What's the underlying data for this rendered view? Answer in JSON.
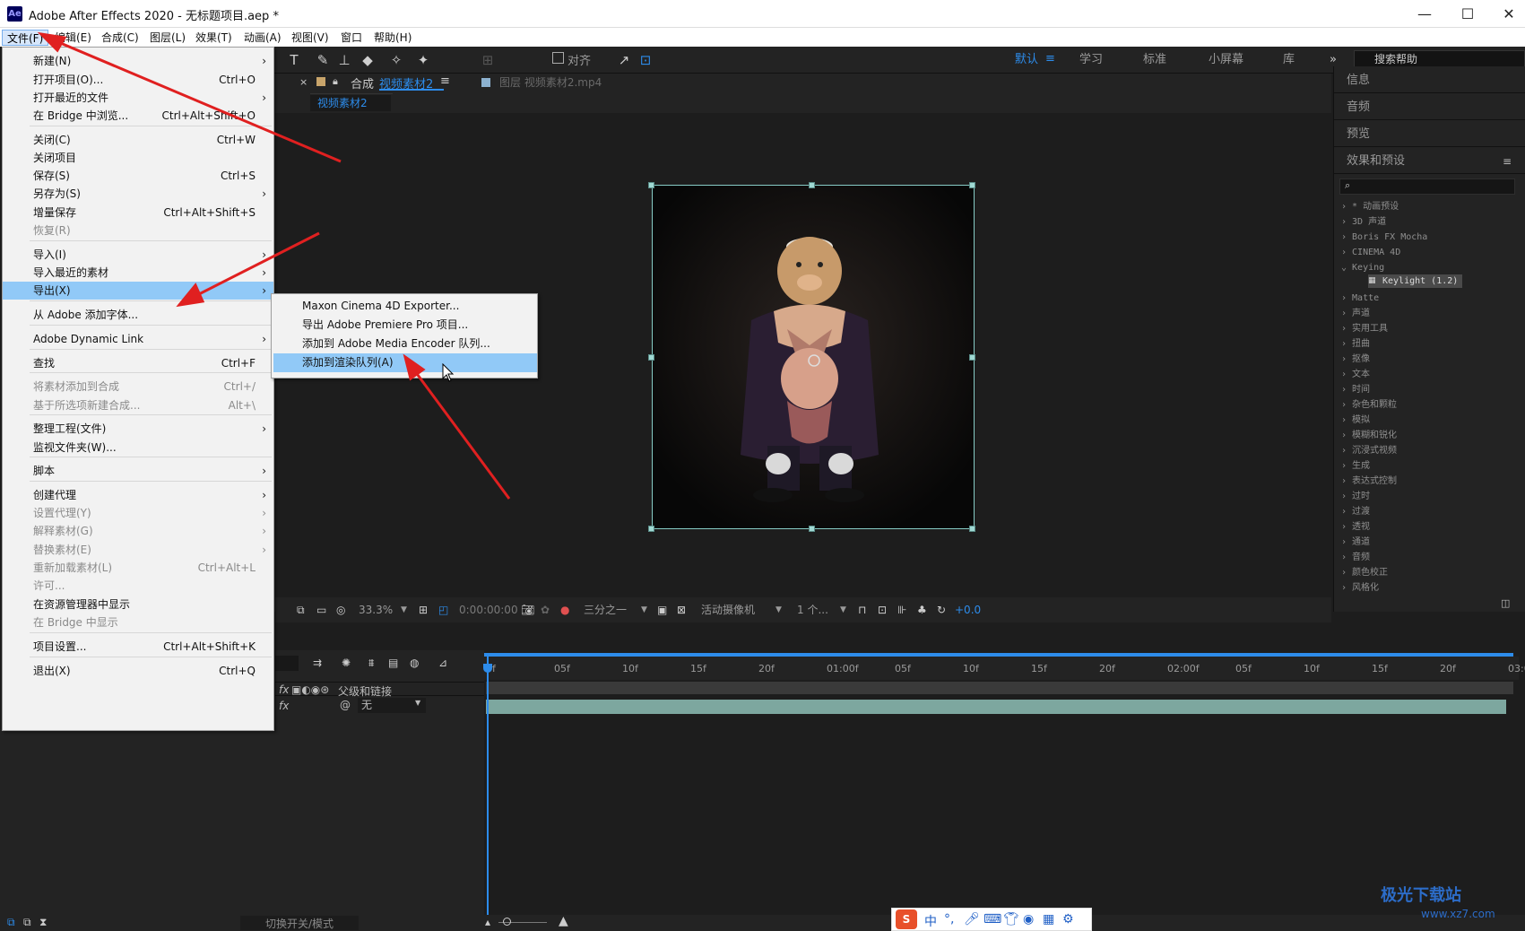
{
  "app": {
    "title": "Adobe After Effects 2020 - 无标题项目.aep *",
    "icon_text": "Ae"
  },
  "window": {
    "minimize": "—",
    "maximize": "☐",
    "close": "✕"
  },
  "menubar": [
    "文件(F)",
    "编辑(E)",
    "合成(C)",
    "图层(L)",
    "效果(T)",
    "动画(A)",
    "视图(V)",
    "窗口",
    "帮助(H)"
  ],
  "toolbar": {
    "align_label": "对齐"
  },
  "workspaces": [
    "默认",
    "学习",
    "标准",
    "小屏幕",
    "库"
  ],
  "help_search": {
    "placeholder": "搜索帮助"
  },
  "file_menu": [
    {
      "label": "新建(N)",
      "shortcut": "",
      "submenu": true,
      "disabled": false
    },
    {
      "label": "打开项目(O)...",
      "shortcut": "Ctrl+O",
      "submenu": false,
      "disabled": false
    },
    {
      "label": "打开最近的文件",
      "shortcut": "",
      "submenu": true,
      "disabled": false
    },
    {
      "label": "在 Bridge 中浏览...",
      "shortcut": "Ctrl+Alt+Shift+O",
      "submenu": false,
      "disabled": false
    },
    {
      "label": "关闭(C)",
      "shortcut": "Ctrl+W",
      "submenu": false,
      "disabled": false
    },
    {
      "label": "关闭项目",
      "shortcut": "",
      "submenu": false,
      "disabled": false
    },
    {
      "label": "保存(S)",
      "shortcut": "Ctrl+S",
      "submenu": false,
      "disabled": false
    },
    {
      "label": "另存为(S)",
      "shortcut": "",
      "submenu": true,
      "disabled": false
    },
    {
      "label": "增量保存",
      "shortcut": "Ctrl+Alt+Shift+S",
      "submenu": false,
      "disabled": false
    },
    {
      "label": "恢复(R)",
      "shortcut": "",
      "submenu": false,
      "disabled": true
    },
    {
      "label": "导入(I)",
      "shortcut": "",
      "submenu": true,
      "disabled": false
    },
    {
      "label": "导入最近的素材",
      "shortcut": "",
      "submenu": true,
      "disabled": false
    },
    {
      "label": "导出(X)",
      "shortcut": "",
      "submenu": true,
      "disabled": false,
      "highlighted": true
    },
    {
      "label": "从 Adobe 添加字体...",
      "shortcut": "",
      "submenu": false,
      "disabled": false
    },
    {
      "label": "Adobe Dynamic Link",
      "shortcut": "",
      "submenu": true,
      "disabled": false
    },
    {
      "label": "查找",
      "shortcut": "Ctrl+F",
      "submenu": false,
      "disabled": false
    },
    {
      "label": "将素材添加到合成",
      "shortcut": "Ctrl+/",
      "submenu": false,
      "disabled": true
    },
    {
      "label": "基于所选项新建合成...",
      "shortcut": "Alt+\\",
      "submenu": false,
      "disabled": true
    },
    {
      "label": "整理工程(文件)",
      "shortcut": "",
      "submenu": true,
      "disabled": false
    },
    {
      "label": "监视文件夹(W)...",
      "shortcut": "",
      "submenu": false,
      "disabled": false
    },
    {
      "label": "脚本",
      "shortcut": "",
      "submenu": true,
      "disabled": false
    },
    {
      "label": "创建代理",
      "shortcut": "",
      "submenu": true,
      "disabled": false
    },
    {
      "label": "设置代理(Y)",
      "shortcut": "",
      "submenu": true,
      "disabled": true
    },
    {
      "label": "解释素材(G)",
      "shortcut": "",
      "submenu": true,
      "disabled": true
    },
    {
      "label": "替换素材(E)",
      "shortcut": "",
      "submenu": true,
      "disabled": true
    },
    {
      "label": "重新加载素材(L)",
      "shortcut": "Ctrl+Alt+L",
      "submenu": false,
      "disabled": true
    },
    {
      "label": "许可...",
      "shortcut": "",
      "submenu": false,
      "disabled": true
    },
    {
      "label": "在资源管理器中显示",
      "shortcut": "",
      "submenu": false,
      "disabled": false
    },
    {
      "label": "在 Bridge 中显示",
      "shortcut": "",
      "submenu": false,
      "disabled": true
    },
    {
      "label": "项目设置...",
      "shortcut": "Ctrl+Alt+Shift+K",
      "submenu": false,
      "disabled": false
    },
    {
      "label": "退出(X)",
      "shortcut": "Ctrl+Q",
      "submenu": false,
      "disabled": false
    }
  ],
  "export_menu": [
    {
      "label": "Maxon Cinema 4D Exporter...",
      "highlighted": false
    },
    {
      "label": "导出 Adobe Premiere Pro 项目...",
      "highlighted": false
    },
    {
      "label": "添加到 Adobe Media Encoder 队列...",
      "highlighted": false
    },
    {
      "label": "添加到渲染队列(A)",
      "highlighted": true
    }
  ],
  "comp": {
    "tab_prefix": "合成",
    "tab_name": "视频素材2",
    "layer_tab": "图层 视频素材2.mp4",
    "subtab": "视频素材2"
  },
  "viewer_bar": {
    "zoom": "33.3%",
    "timecode": "0:00:00:00",
    "resolution": "三分之一",
    "camera": "活动摄像机",
    "views": "1 个...",
    "exposure": "+0.0"
  },
  "right_panel": {
    "headers": [
      "信息",
      "音频",
      "预览",
      "效果和预设"
    ]
  },
  "effects": [
    "* 动画预设",
    "3D 声道",
    "Boris FX Mocha",
    "CINEMA 4D",
    "Keying",
    "Matte",
    "声道",
    "实用工具",
    "扭曲",
    "抠像",
    "文本",
    "时间",
    "杂色和颗粒",
    "模拟",
    "模糊和锐化",
    "沉浸式视频",
    "生成",
    "表达式控制",
    "过时",
    "过渡",
    "透视",
    "通道",
    "音频",
    "颜色校正",
    "风格化"
  ],
  "keylight": "Keylight (1.2)",
  "timeline": {
    "ruler": [
      "0f",
      "05f",
      "10f",
      "15f",
      "20f",
      "01:00f",
      "05f",
      "10f",
      "15f",
      "20f",
      "02:00f",
      "05f",
      "10f",
      "15f",
      "20f",
      "03:0"
    ],
    "parent_header": "父级和链接",
    "parent_value": "无"
  },
  "statusbar": {
    "toggle_label": "切换开关/模式"
  },
  "ime": {
    "label": "中"
  },
  "watermark": {
    "name": "极光下载站",
    "url": "www.xz7.com"
  }
}
